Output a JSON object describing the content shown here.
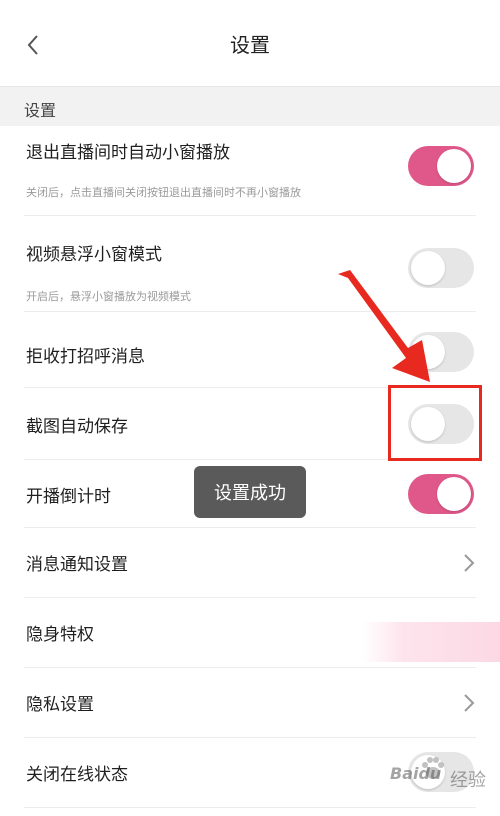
{
  "header": {
    "title": "设置",
    "back_icon": "chevron-left-icon"
  },
  "section": {
    "label": "设置"
  },
  "rows": [
    {
      "title": "退出直播间时自动小窗播放",
      "desc": "关闭后，点击直播间关闭按钮退出直播间时不再小窗播放",
      "control": "toggle",
      "state": "on"
    },
    {
      "title": "视频悬浮小窗模式",
      "desc": "开启后，悬浮小窗播放为视频模式",
      "control": "toggle",
      "state": "off"
    },
    {
      "title": "拒收打招呼消息",
      "control": "toggle",
      "state": "off"
    },
    {
      "title": "截图自动保存",
      "control": "toggle",
      "state": "off"
    },
    {
      "title": "开播倒计时",
      "control": "toggle",
      "state": "on"
    },
    {
      "title": "消息通知设置",
      "control": "chevron"
    },
    {
      "title": "隐身特权",
      "control": "none"
    },
    {
      "title": "隐私设置",
      "control": "chevron"
    },
    {
      "title": "关闭在线状态",
      "control": "toggle",
      "state": "off"
    }
  ],
  "toast": {
    "text": "设置成功"
  },
  "colors": {
    "toggle_on": "#e0588a",
    "toggle_off": "#e6e6e6",
    "annotation": "#e8291f",
    "section_bg": "#f2f2f2"
  },
  "watermark": {
    "brand": "Baidu",
    "label": "经验",
    "icon": "baidu-paw-icon"
  }
}
